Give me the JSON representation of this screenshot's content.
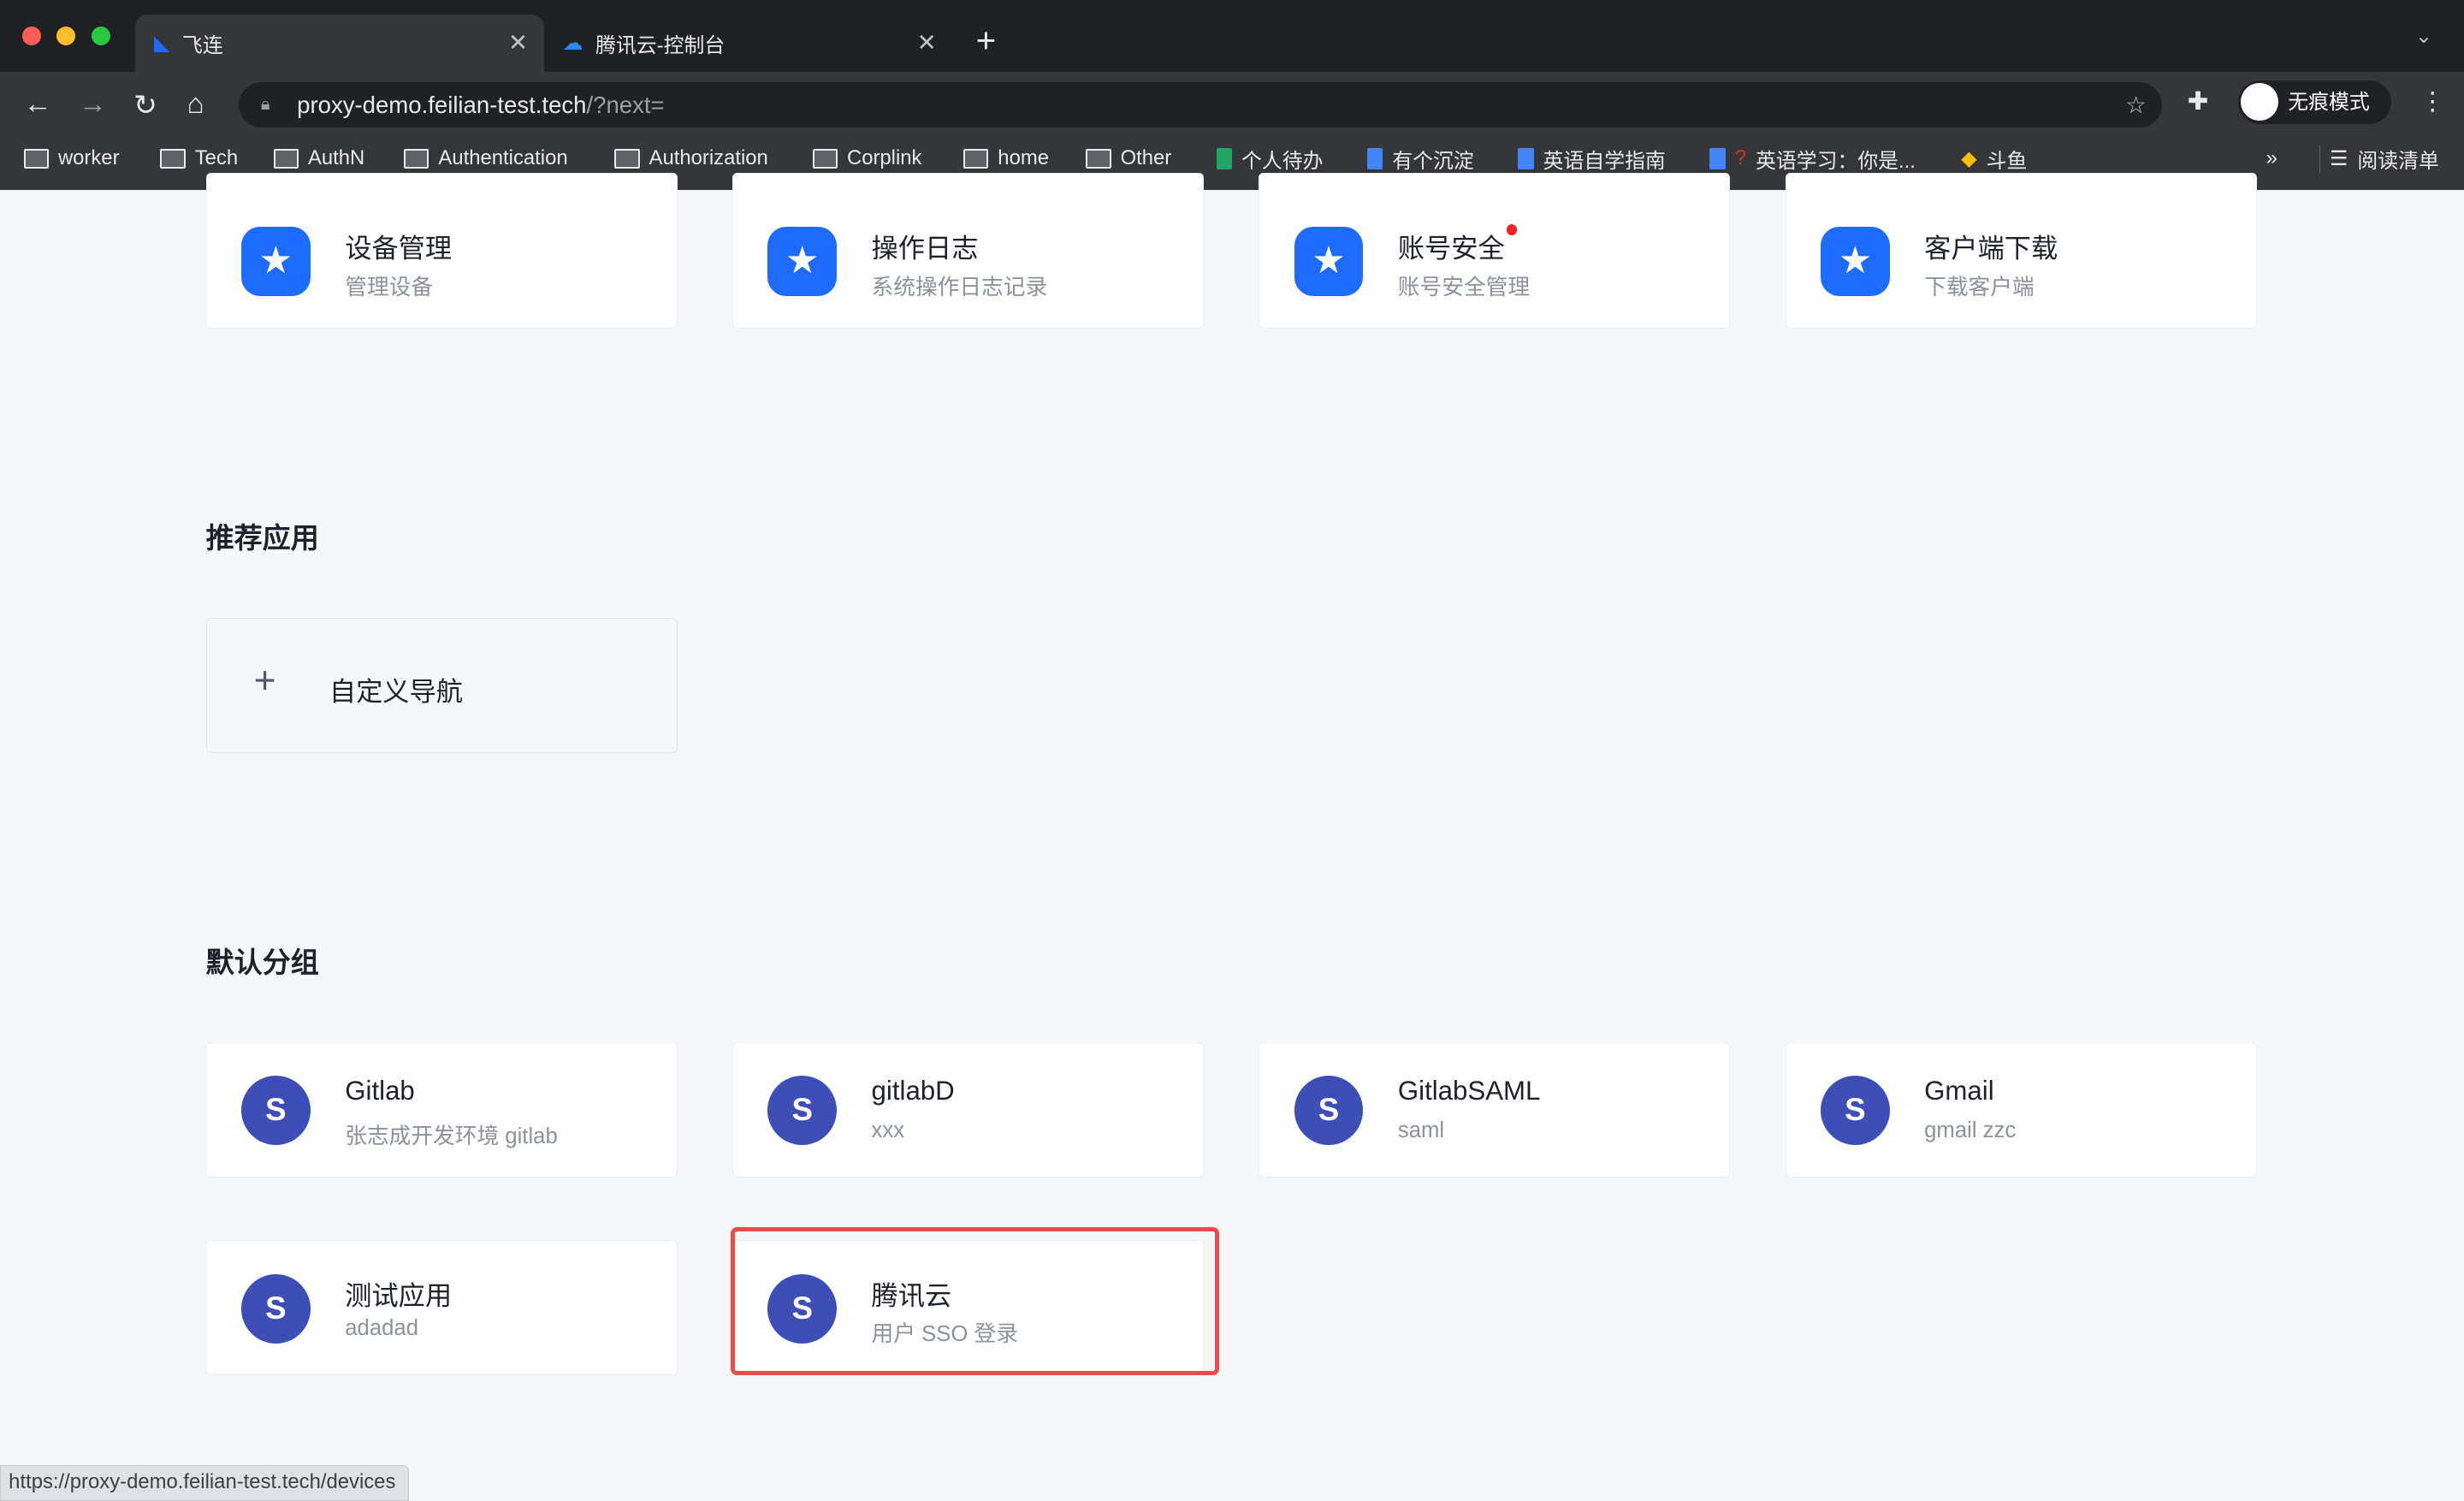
{
  "browser": {
    "tabs": [
      {
        "title": "飞连",
        "active": true
      },
      {
        "title": "腾讯云-控制台",
        "active": false
      }
    ],
    "url_host": "proxy-demo.feilian-test.tech",
    "url_path": "/?next=",
    "bookmarks": [
      "worker",
      "Tech",
      "AuthN",
      "Authentication",
      "Authorization",
      "Corplink",
      "home",
      "Other",
      "个人待办",
      "有个沉淀",
      "英语自学指南",
      "英语学习：你是...",
      "斗鱼"
    ],
    "incognito_label": "无痕模式",
    "reading_list": "阅读清单",
    "more": "»"
  },
  "top_cards": [
    {
      "title": "设备管理",
      "subtitle": "管理设备"
    },
    {
      "title": "操作日志",
      "subtitle": "系统操作日志记录"
    },
    {
      "title": "账号安全",
      "subtitle": "账号安全管理",
      "badge": true
    },
    {
      "title": "客户端下载",
      "subtitle": "下载客户端"
    }
  ],
  "recommended": {
    "heading": "推荐应用",
    "custom_nav": "自定义导航"
  },
  "default_group": {
    "heading": "默认分组",
    "apps": [
      {
        "title": "Gitlab",
        "subtitle": "张志成开发环境 gitlab"
      },
      {
        "title": "gitlabD",
        "subtitle": "xxx"
      },
      {
        "title": "GitlabSAML",
        "subtitle": "saml"
      },
      {
        "title": "Gmail",
        "subtitle": "gmail zzc"
      },
      {
        "title": "测试应用",
        "subtitle": "adadad"
      },
      {
        "title": "腾讯云",
        "subtitle": "用户 SSO 登录",
        "highlighted": true
      }
    ]
  },
  "status_url": "https://proxy-demo.feilian-test.tech/devices",
  "colors": {
    "accent": "#1e6bff",
    "app_icon": "#3d4fb6",
    "highlight": "#f04a4a"
  }
}
